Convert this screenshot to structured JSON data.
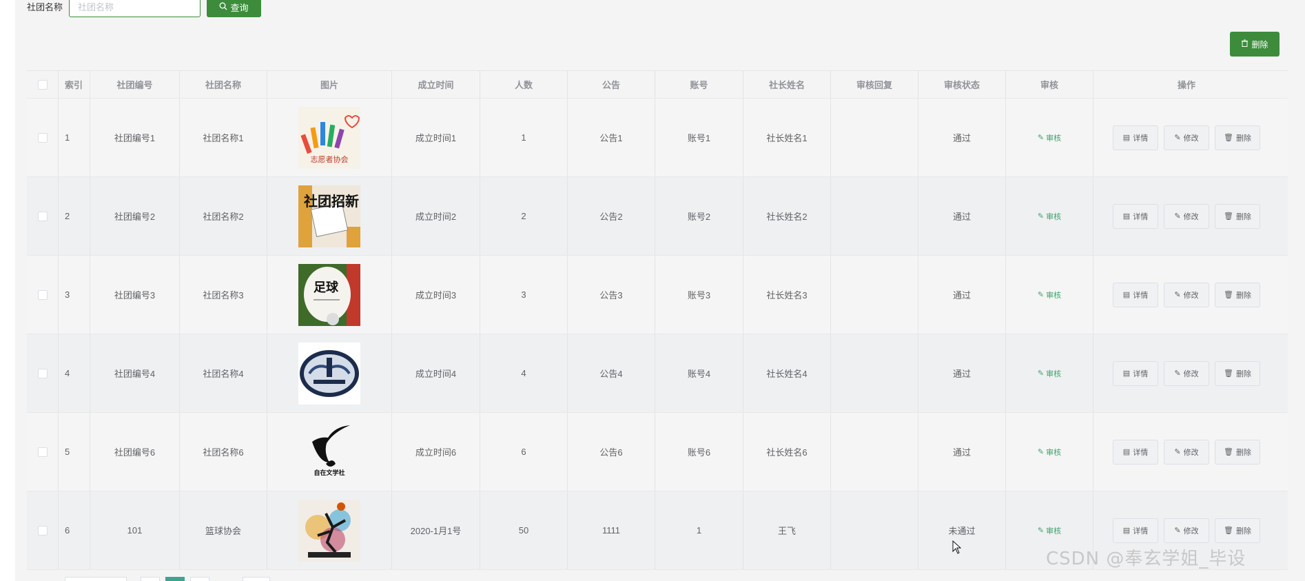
{
  "search": {
    "label": "社团名称",
    "placeholder": "社团名称",
    "value": "",
    "button_label": "查询"
  },
  "toolbar": {
    "delete_label": "删除"
  },
  "table": {
    "headers": {
      "index": "索引",
      "code": "社团编号",
      "name": "社团名称",
      "image": "图片",
      "time": "成立时间",
      "count": "人数",
      "notice": "公告",
      "account": "账号",
      "leader": "社长姓名",
      "reply": "审核回复",
      "status": "审核状态",
      "audit": "审核",
      "ops": "操作"
    },
    "rows": [
      {
        "index": "1",
        "code": "社团编号1",
        "name": "社团名称1",
        "time": "成立时间1",
        "count": "1",
        "notice": "公告1",
        "account": "账号1",
        "leader": "社长姓名1",
        "reply": "",
        "status": "通过",
        "audit": "审核"
      },
      {
        "index": "2",
        "code": "社团编号2",
        "name": "社团名称2",
        "time": "成立时间2",
        "count": "2",
        "notice": "公告2",
        "account": "账号2",
        "leader": "社长姓名2",
        "reply": "",
        "status": "通过",
        "audit": "审核"
      },
      {
        "index": "3",
        "code": "社团编号3",
        "name": "社团名称3",
        "time": "成立时间3",
        "count": "3",
        "notice": "公告3",
        "account": "账号3",
        "leader": "社长姓名3",
        "reply": "",
        "status": "通过",
        "audit": "审核"
      },
      {
        "index": "4",
        "code": "社团编号4",
        "name": "社团名称4",
        "time": "成立时间4",
        "count": "4",
        "notice": "公告4",
        "account": "账号4",
        "leader": "社长姓名4",
        "reply": "",
        "status": "通过",
        "audit": "审核"
      },
      {
        "index": "5",
        "code": "社团编号6",
        "name": "社团名称6",
        "time": "成立时间6",
        "count": "6",
        "notice": "公告6",
        "account": "账号6",
        "leader": "社长姓名6",
        "reply": "",
        "status": "通过",
        "audit": "审核"
      },
      {
        "index": "6",
        "code": "101",
        "name": "篮球协会",
        "time": "2020-1月1号",
        "count": "50",
        "notice": "1111",
        "account": "1",
        "leader": "王飞",
        "reply": "",
        "status": "未通过",
        "audit": "审核"
      }
    ],
    "ops": {
      "detail": "详情",
      "edit": "修改",
      "delete": "删除"
    }
  },
  "thumbnails": [
    {
      "icon": "colorful-hands-image",
      "text": "志愿者协会"
    },
    {
      "icon": "club-recruit-image",
      "text": "社团招新"
    },
    {
      "icon": "football-image",
      "text": "足球"
    },
    {
      "icon": "club-emblem-image",
      "text": ""
    },
    {
      "icon": "literature-club-logo-image",
      "text": "自在文学社"
    },
    {
      "icon": "basketball-poster-image",
      "text": ""
    }
  ],
  "watermark": "CSDN @奉玄学姐_毕设",
  "colors": {
    "primary": "#3c8c3c",
    "audit_link": "#3fa36c",
    "pager_active": "#3fa38f"
  }
}
